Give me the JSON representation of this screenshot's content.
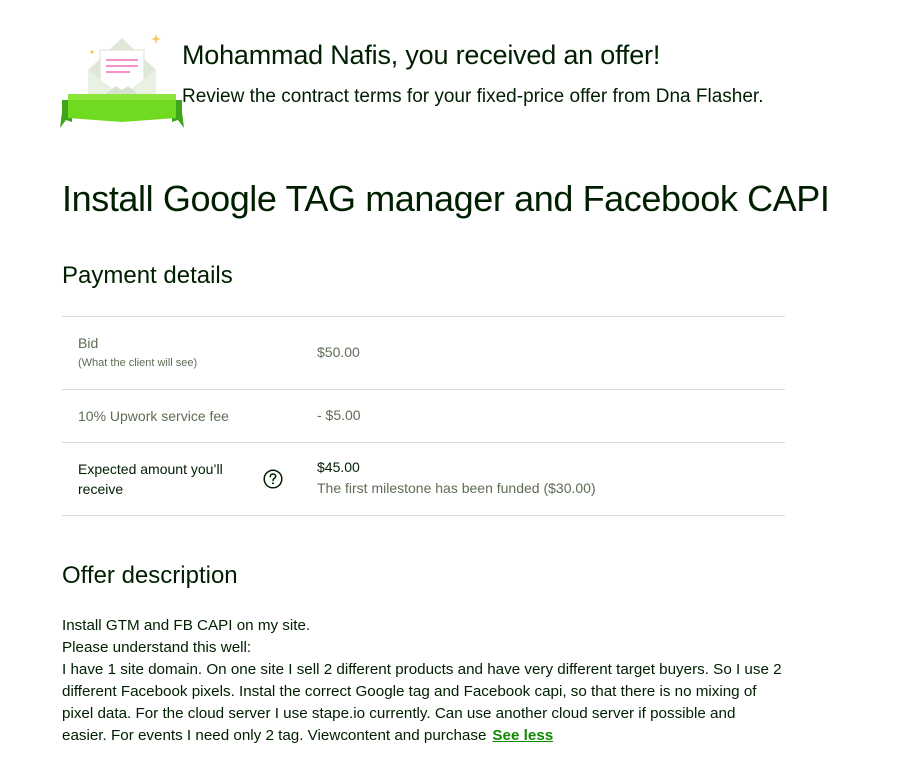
{
  "header": {
    "greeting": "Mohammad Nafis, you received an offer!",
    "subtitle": "Review the contract terms for your fixed-price offer from Dna Flasher.",
    "illustration_icon": "envelope-ribbon-icon"
  },
  "job": {
    "title": "Install Google TAG manager and Facebook CAPI"
  },
  "payment": {
    "section_title": "Payment details",
    "bid": {
      "label": "Bid",
      "sublabel": "(What the client will see)",
      "value": "$50.00"
    },
    "fee": {
      "label": "10% Upwork service fee",
      "value": "- $5.00"
    },
    "expected": {
      "label": "Expected amount you’ll receive",
      "value": "$45.00",
      "note": "The first milestone has been funded ($30.00)",
      "help_icon": "question-circle-icon"
    }
  },
  "offer": {
    "section_title": "Offer description",
    "lines": [
      "Install GTM and FB CAPI on my site.",
      "Please understand this well:",
      "I have 1 site domain. On one site I sell 2 different products and have very different target buyers. So I use 2 different Facebook pixels. Instal the correct Google tag and Facebook capi, so that there is no mixing of pixel data. For the cloud server I use stape.io currently. Can use another cloud server if possible and easier. For events I need only 2 tag. Viewcontent and purchase"
    ],
    "see_less_label": "See less"
  },
  "colors": {
    "text_primary": "#001e00",
    "text_muted": "#5e6d55",
    "divider": "#d5e0d5",
    "link_green": "#108a00",
    "ribbon_green": "#6fda20"
  }
}
